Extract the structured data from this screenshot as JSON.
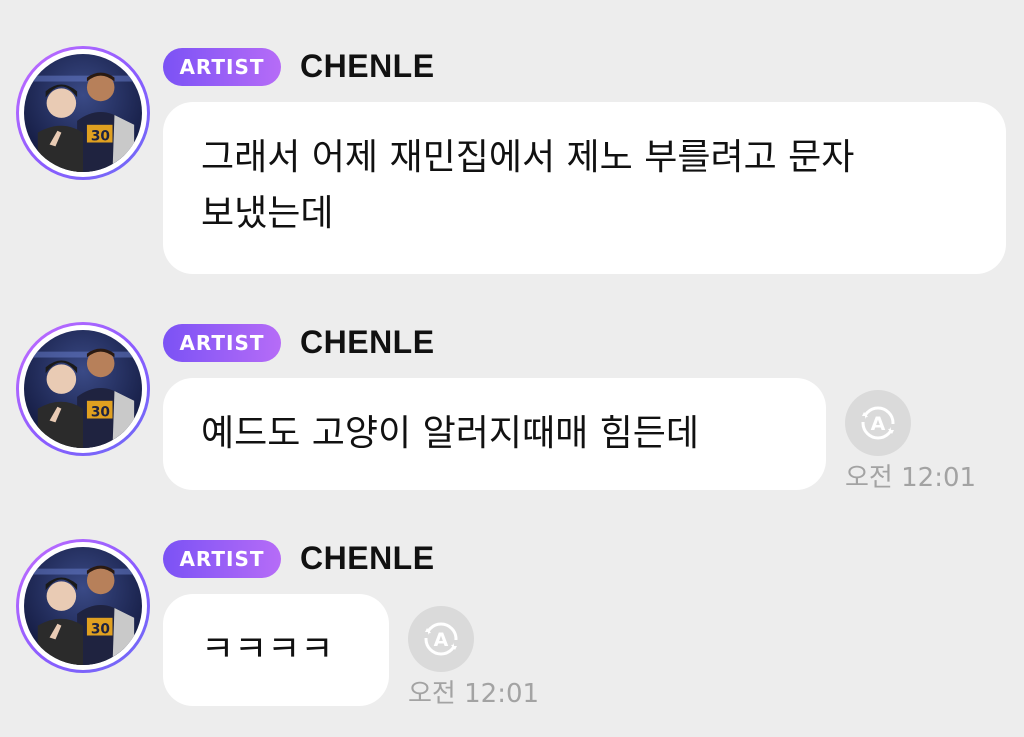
{
  "messages": [
    {
      "badge": "ARTIST",
      "name": "CHENLE",
      "text_line1": "그래서 어제 재민집에서 제노 부를려고 문자",
      "text_line2": "보냈는데"
    },
    {
      "badge": "ARTIST",
      "name": "CHENLE",
      "text": "예드도 고양이 알러지때매 힘든데",
      "time": "오전 12:01"
    },
    {
      "badge": "ARTIST",
      "name": "CHENLE",
      "text": "ㅋㅋㅋㅋ",
      "time": "오전 12:01"
    }
  ],
  "colors": {
    "background": "#ededed",
    "bubble": "#ffffff",
    "badge_start": "#7b52f5",
    "badge_end": "#b66cf7",
    "timestamp": "#a3a3a3"
  },
  "icons": {
    "translate": "translate-icon",
    "avatar": "profile-photo"
  }
}
